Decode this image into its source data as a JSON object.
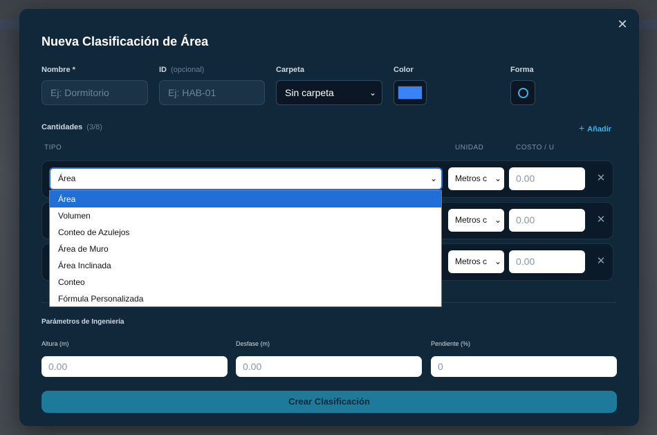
{
  "modal": {
    "title": "Nueva Clasificación de Área",
    "close_glyph": "✕"
  },
  "fields": {
    "nombre": {
      "label": "Nombre *",
      "placeholder": "Ej: Dormitorio"
    },
    "id": {
      "label": "ID",
      "hint": "(opcional)",
      "placeholder": "Ej: HAB-01"
    },
    "carpeta": {
      "label": "Carpeta",
      "value": "Sin carpeta"
    },
    "color": {
      "label": "Color",
      "value": "#3b82f6"
    },
    "forma": {
      "label": "Forma",
      "icon": "circle-outline-icon"
    }
  },
  "cantidades": {
    "label": "Cantidades",
    "count": "(3/8)",
    "add_label": "Añadir",
    "columns": {
      "tipo": "TIPO",
      "unidad": "UNIDAD",
      "costo": "COSTO / U"
    },
    "rows": [
      {
        "tipo": "Área",
        "unidad": "Metros c",
        "costo_placeholder": "0.00"
      },
      {
        "tipo": "",
        "unidad": "Metros c",
        "costo_placeholder": "0.00"
      },
      {
        "tipo": "",
        "unidad": "Metros c",
        "costo_placeholder": "0.00"
      }
    ],
    "dropdown_options": [
      "Área",
      "Volumen",
      "Conteo de Azulejos",
      "Área de Muro",
      "Área Inclinada",
      "Conteo",
      "Fórmula Personalizada"
    ],
    "dropdown_selected": "Área"
  },
  "ingenieria": {
    "title": "Parámetros de Ingeniería",
    "altura": {
      "label": "Altura (m)",
      "placeholder": "0.00"
    },
    "desfase": {
      "label": "Desfase (m)",
      "placeholder": "0.00"
    },
    "pendiente": {
      "label": "Pendiente (%)",
      "placeholder": "0"
    }
  },
  "submit": {
    "label": "Crear Clasificación"
  }
}
